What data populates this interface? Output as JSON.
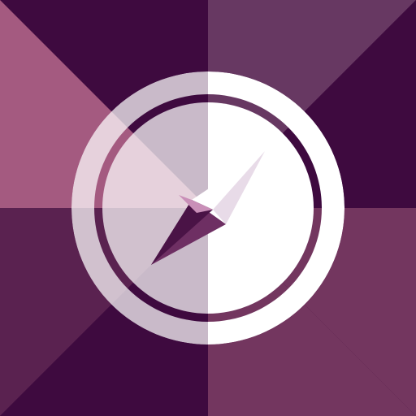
{
  "colors": {
    "dark_plum": "#3e0a3f",
    "mauve": "#a45a80",
    "dusky_purple": "#673862",
    "deep_purple": "#5a2250",
    "berry": "#73365f",
    "white": "#ffffff",
    "glass": "#e8dbe8",
    "pink_highlight": "#c98fb8"
  },
  "icon": {
    "name": "compass-icon"
  }
}
